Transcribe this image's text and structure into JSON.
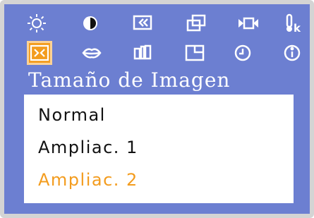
{
  "menu": {
    "title": "Tamaño de Imagen",
    "icons_row1": [
      "brightness-icon",
      "contrast-icon",
      "position-icon",
      "size-icon",
      "video-icon",
      "color-temperature-icon"
    ],
    "icons_row2": [
      "image-size-icon",
      "lips-icon",
      "panels-icon",
      "window-icon",
      "clock-icon",
      "info-icon"
    ],
    "temperature_glyph": "k",
    "selected_icon": "image-size-icon",
    "options": [
      "Normal",
      "Ampliac. 1",
      "Ampliac. 2"
    ],
    "selected_option": "Ampliac. 2"
  },
  "colors": {
    "background": "#6c7fd1",
    "highlight": "#f39c1e",
    "panel": "#ffffff",
    "text": "#111111"
  }
}
